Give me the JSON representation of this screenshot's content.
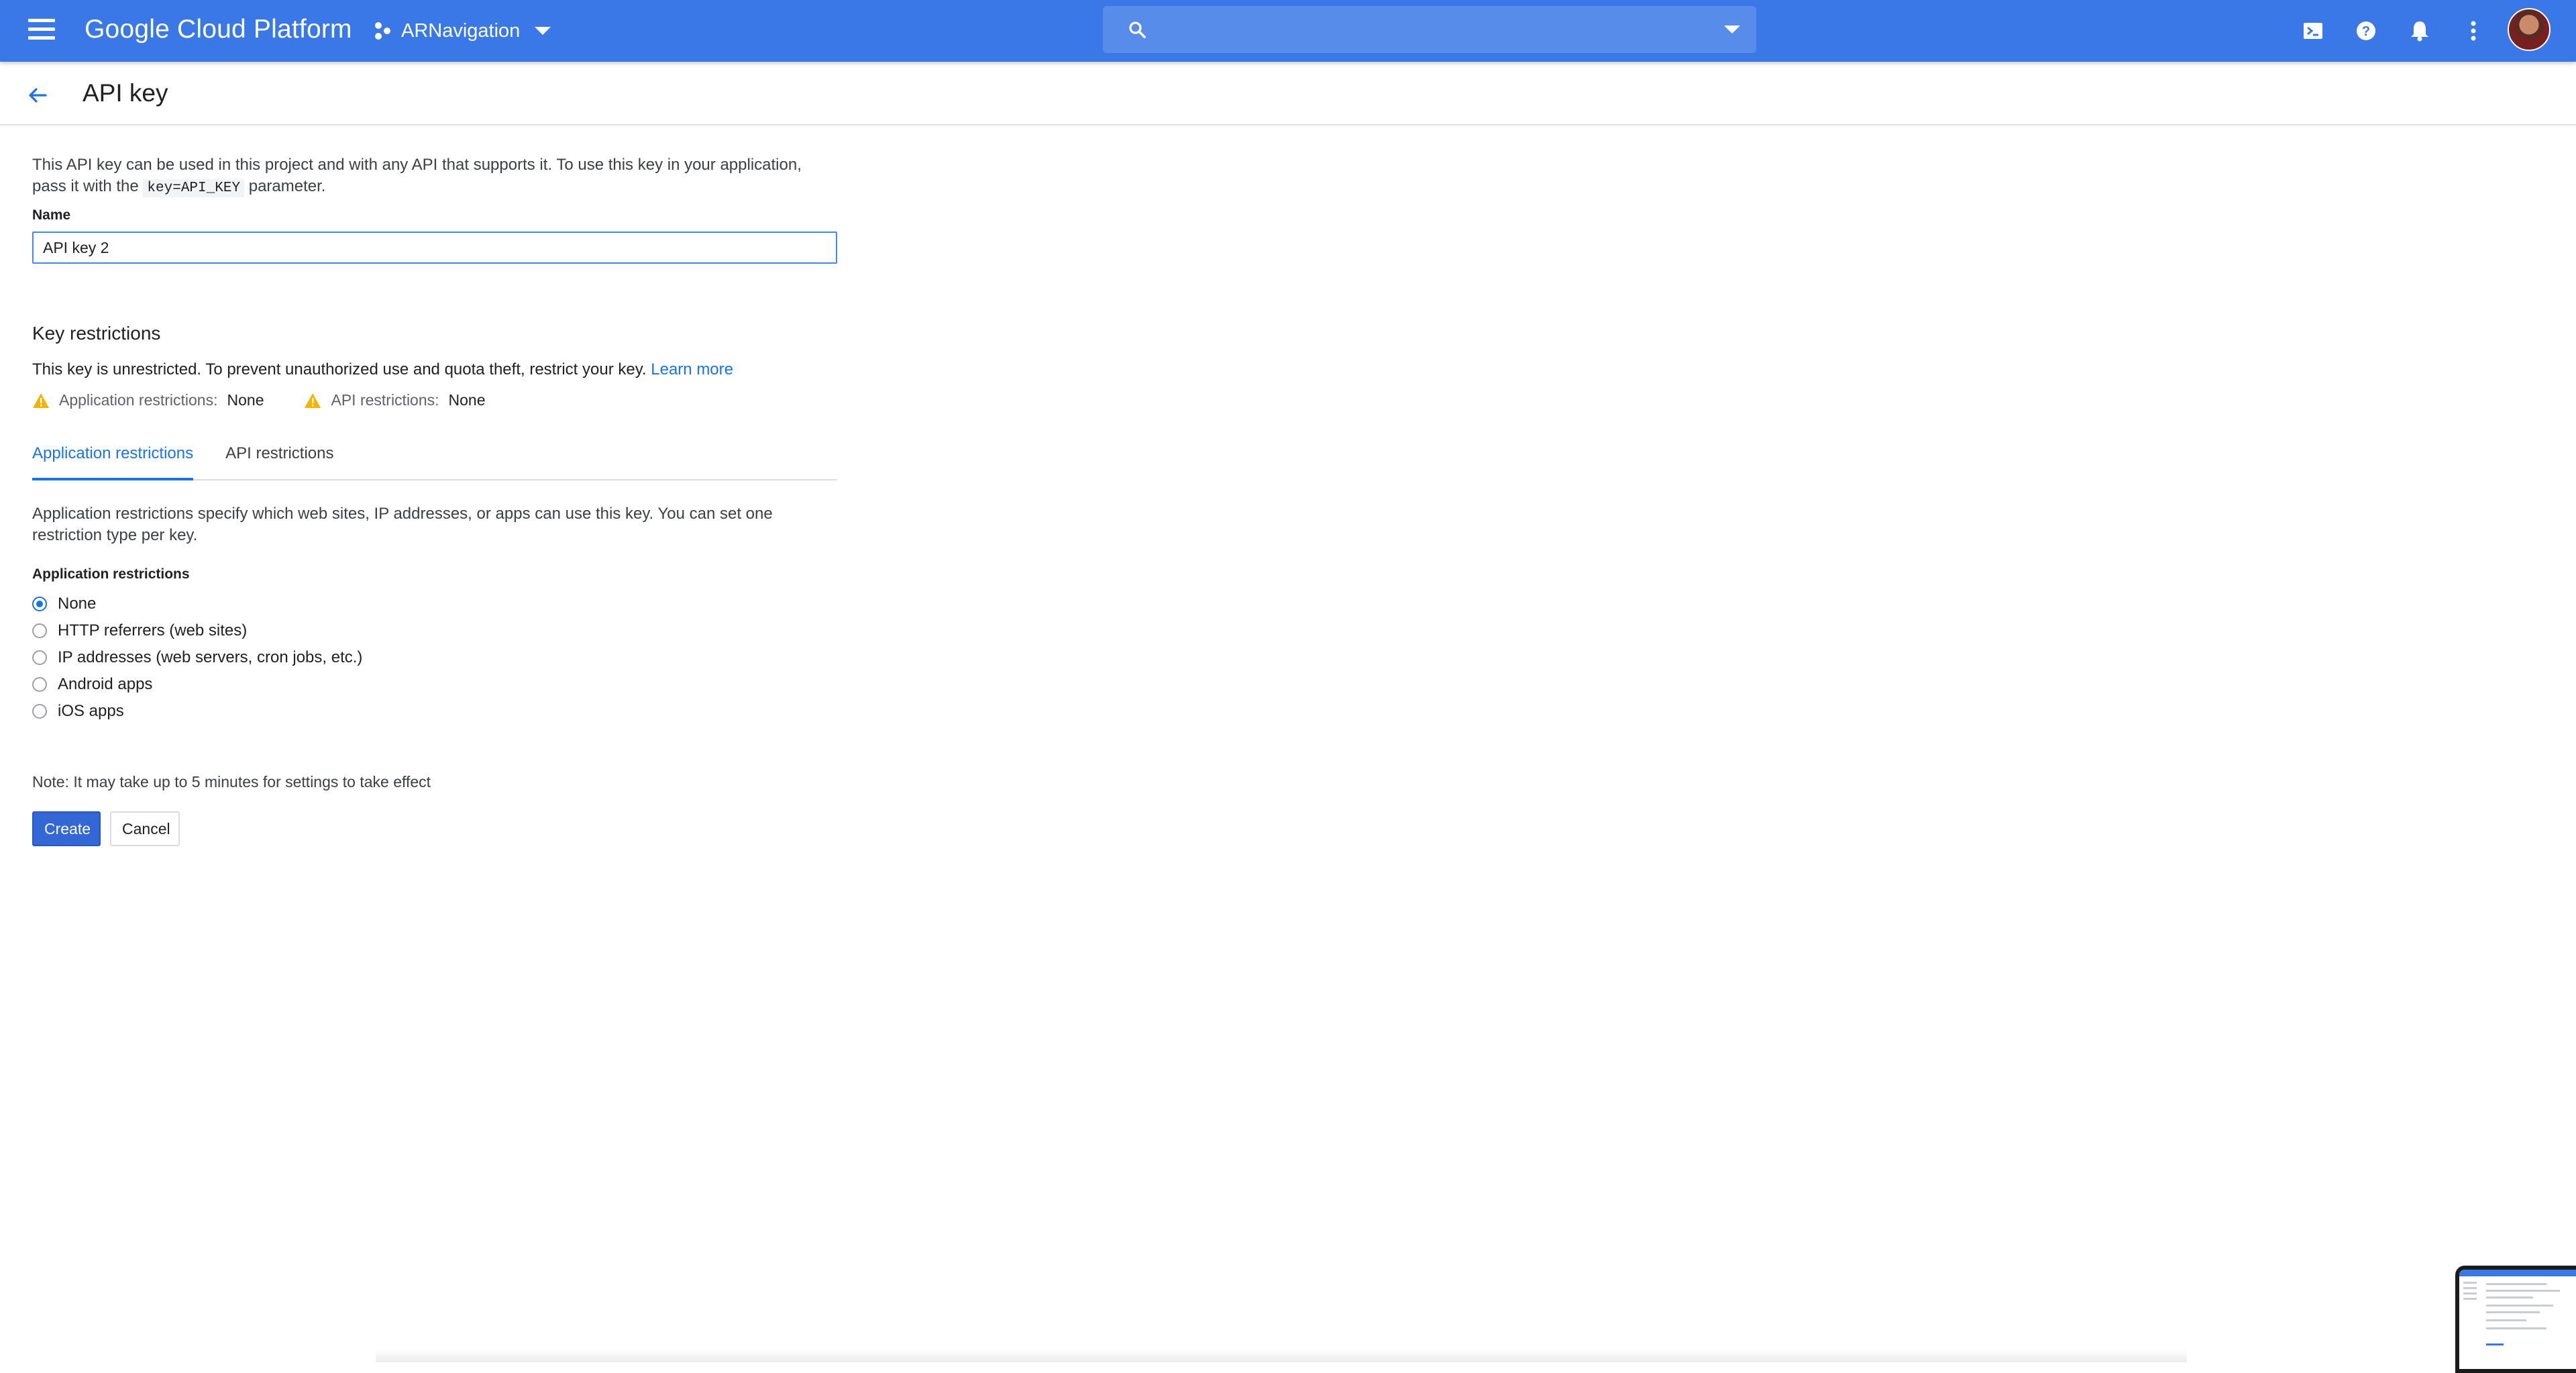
{
  "topbar": {
    "brand": "Google Cloud Platform",
    "project_name": "ARNavigation",
    "search_placeholder": "",
    "icons": [
      "menu-icon",
      "project-icon",
      "search-icon",
      "cloud-shell-icon",
      "help-icon",
      "notifications-icon",
      "more-vert-icon",
      "avatar"
    ],
    "color": "#3b78e7"
  },
  "page": {
    "title": "API key"
  },
  "intro": {
    "text_before": "This API key can be used in this project and with any API that supports it. To use this key in your application, pass it with the",
    "code": "key=API_KEY",
    "text_after": "parameter."
  },
  "name_field": {
    "label": "Name",
    "value": "API key 2"
  },
  "restrictions": {
    "title": "Key restrictions",
    "warning": "This key is unrestricted. To prevent unauthorized use and quota theft, restrict your key.",
    "learn_more": "Learn more",
    "app_label": "Application restrictions:",
    "app_value": "None",
    "api_label": "API restrictions:",
    "api_value": "None",
    "warning_color": "#f4b400"
  },
  "tabs": [
    {
      "label": "Application restrictions",
      "active": true
    },
    {
      "label": "API restrictions",
      "active": false
    }
  ],
  "app_restrictions": {
    "description": "Application restrictions specify which web sites, IP addresses, or apps can use this key. You can set one restriction type per key.",
    "heading": "Application restrictions",
    "options": [
      "None",
      "HTTP referrers (web sites)",
      "IP addresses (web servers, cron jobs, etc.)",
      "Android apps",
      "iOS apps"
    ],
    "selected": "None"
  },
  "note": "Note: It may take up to 5 minutes for settings to take effect",
  "buttons": {
    "create": "Create",
    "cancel": "Cancel"
  }
}
